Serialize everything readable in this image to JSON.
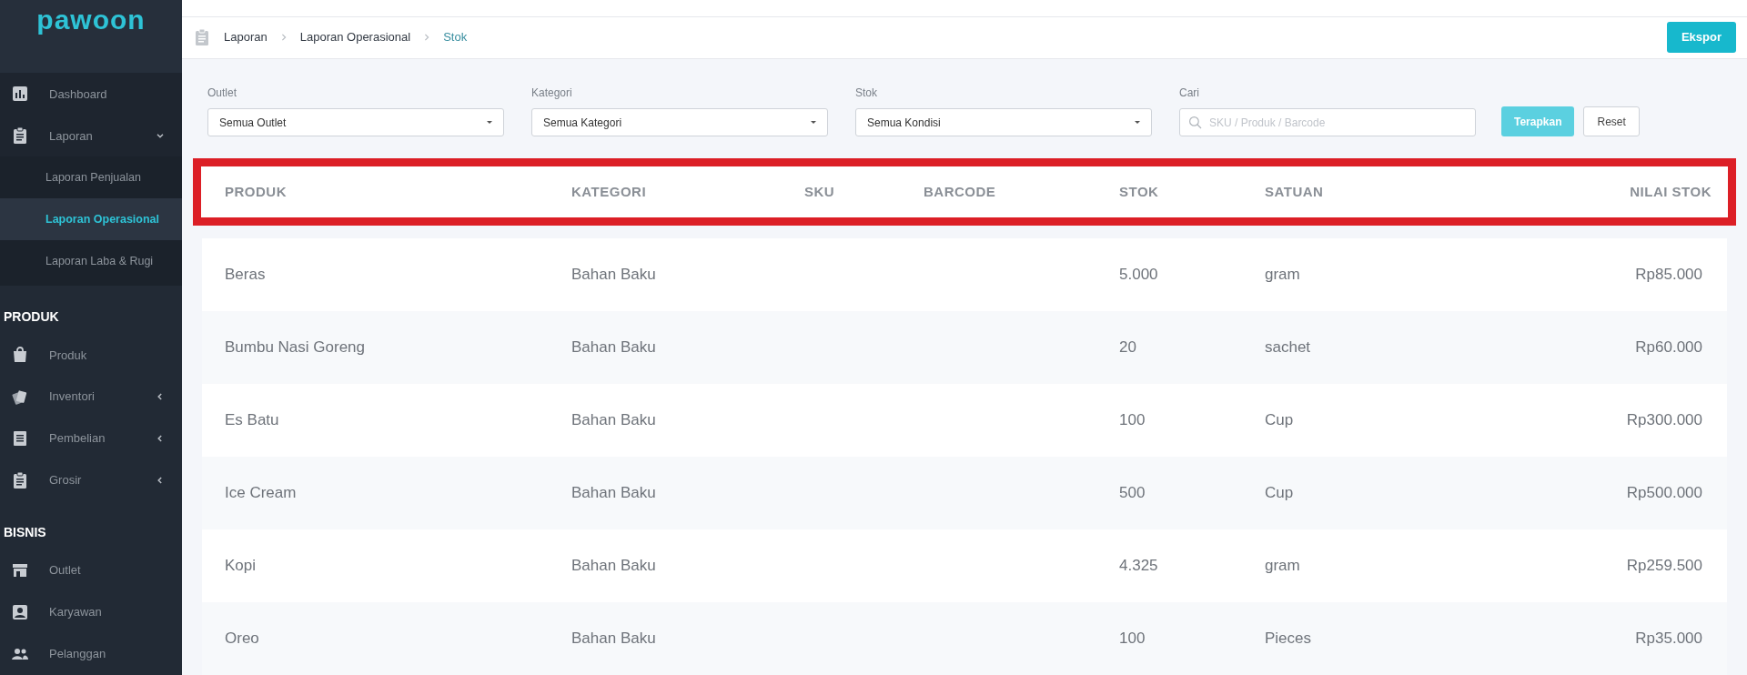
{
  "sidebar": {
    "logo": "pawoon",
    "sections": [
      {
        "items": [
          {
            "label": "Dashboard",
            "selected": false
          },
          {
            "label": "Laporan",
            "selected": false,
            "expanded": true,
            "children": [
              {
                "label": "Laporan Penjualan",
                "selected": false
              },
              {
                "label": "Laporan Operasional",
                "selected": true
              },
              {
                "label": "Laporan Laba & Rugi",
                "selected": false
              }
            ]
          }
        ]
      },
      {
        "heading": "PRODUK",
        "items": [
          {
            "label": "Produk",
            "selected": false
          },
          {
            "label": "Inventori",
            "selected": false,
            "expanded": false
          },
          {
            "label": "Pembelian",
            "selected": false,
            "expanded": false
          },
          {
            "label": "Grosir",
            "selected": false,
            "expanded": false
          }
        ]
      },
      {
        "heading": "BISNIS",
        "items": [
          {
            "label": "Outlet",
            "selected": false
          },
          {
            "label": "Karyawan",
            "selected": false
          },
          {
            "label": "Pelanggan",
            "selected": false
          }
        ]
      }
    ]
  },
  "breadcrumb": [
    {
      "label": "Laporan",
      "current": false
    },
    {
      "label": "Laporan Operasional",
      "current": false
    },
    {
      "label": "Stok",
      "current": true
    }
  ],
  "export_button": "Ekspor",
  "filters": [
    {
      "label": "Outlet",
      "kind": "select",
      "value": "Semua Outlet"
    },
    {
      "label": "Kategori",
      "kind": "select",
      "value": "Semua Kategori"
    },
    {
      "label": "Stok",
      "kind": "select",
      "value": "Semua Kondisi"
    },
    {
      "label": "Cari",
      "kind": "search",
      "placeholder": "SKU / Produk / Barcode"
    }
  ],
  "apply_button": "Terapkan",
  "reset_button": "Reset",
  "table": {
    "header_highlighted": true,
    "columns": [
      "PRODUK",
      "KATEGORI",
      "SKU",
      "BARCODE",
      "STOK",
      "SATUAN",
      "NILAI STOK"
    ],
    "rows": [
      [
        "Beras",
        "Bahan Baku",
        "",
        "",
        "5.000",
        "gram",
        "Rp85.000"
      ],
      [
        "Bumbu Nasi Goreng",
        "Bahan Baku",
        "",
        "",
        "20",
        "sachet",
        "Rp60.000"
      ],
      [
        "Es Batu",
        "Bahan Baku",
        "",
        "",
        "100",
        "Cup",
        "Rp300.000"
      ],
      [
        "Ice Cream",
        "Bahan Baku",
        "",
        "",
        "500",
        "Cup",
        "Rp500.000"
      ],
      [
        "Kopi",
        "Bahan Baku",
        "",
        "",
        "4.325",
        "gram",
        "Rp259.500"
      ],
      [
        "Oreo",
        "Bahan Baku",
        "",
        "",
        "100",
        "Pieces",
        "Rp35.000"
      ]
    ]
  }
}
